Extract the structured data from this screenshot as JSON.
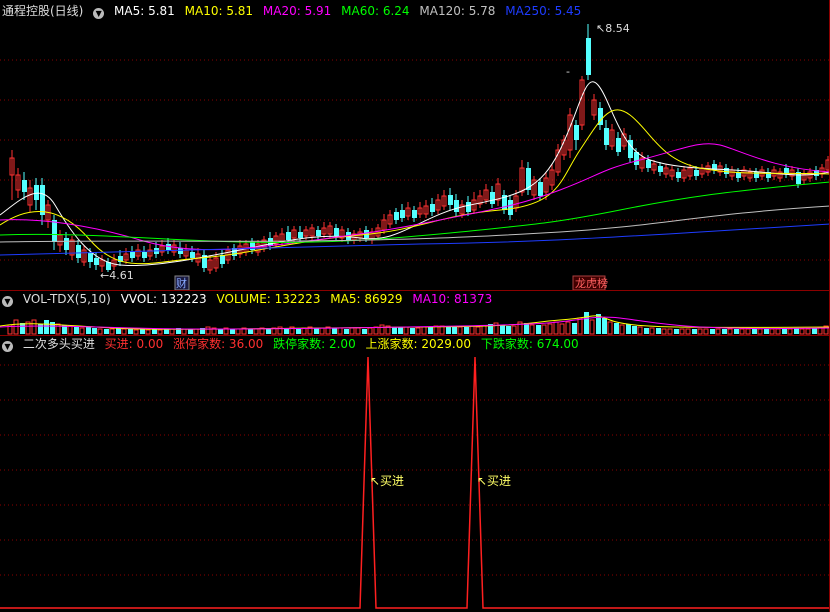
{
  "main": {
    "title": "通程控股(日线)",
    "ma": [
      {
        "label": "MA5: 5.81",
        "color": "#ffffff"
      },
      {
        "label": "MA10: 5.81",
        "color": "#ffff00"
      },
      {
        "label": "MA20: 5.91",
        "color": "#ff00ff"
      },
      {
        "label": "MA60: 6.24",
        "color": "#00ff00"
      },
      {
        "label": "MA120: 5.78",
        "color": "#c0c0c0"
      },
      {
        "label": "MA250: 5.45",
        "color": "#1e3cff"
      }
    ],
    "high_label": "8.54",
    "low_label": "4.61",
    "tag_cai": "财",
    "tag_longhu": "龙虎榜"
  },
  "vol": {
    "title": "VOL-TDX(5,10)",
    "items": [
      {
        "label": "VVOL: 132223",
        "color": "#ffffff"
      },
      {
        "label": "VOLUME: 132223",
        "color": "#ffff00"
      },
      {
        "label": "MA5: 86929",
        "color": "#ffff00"
      },
      {
        "label": "MA10: 81373",
        "color": "#ff00ff"
      }
    ]
  },
  "ind": {
    "title": "二次多头买进",
    "items": [
      {
        "label": "买进: 0.00",
        "color": "#ff3030"
      },
      {
        "label": "涨停家数: 36.00",
        "color": "#ff3030"
      },
      {
        "label": "跌停家数: 2.00",
        "color": "#00ff00"
      },
      {
        "label": "上涨家数: 2029.00",
        "color": "#ffff00"
      },
      {
        "label": "下跌家数: 674.00",
        "color": "#00ff00"
      }
    ],
    "signal_label": "买进"
  },
  "colors": {
    "up": "#ff3232",
    "down": "#54ffff",
    "grid": "#8b0000"
  }
}
